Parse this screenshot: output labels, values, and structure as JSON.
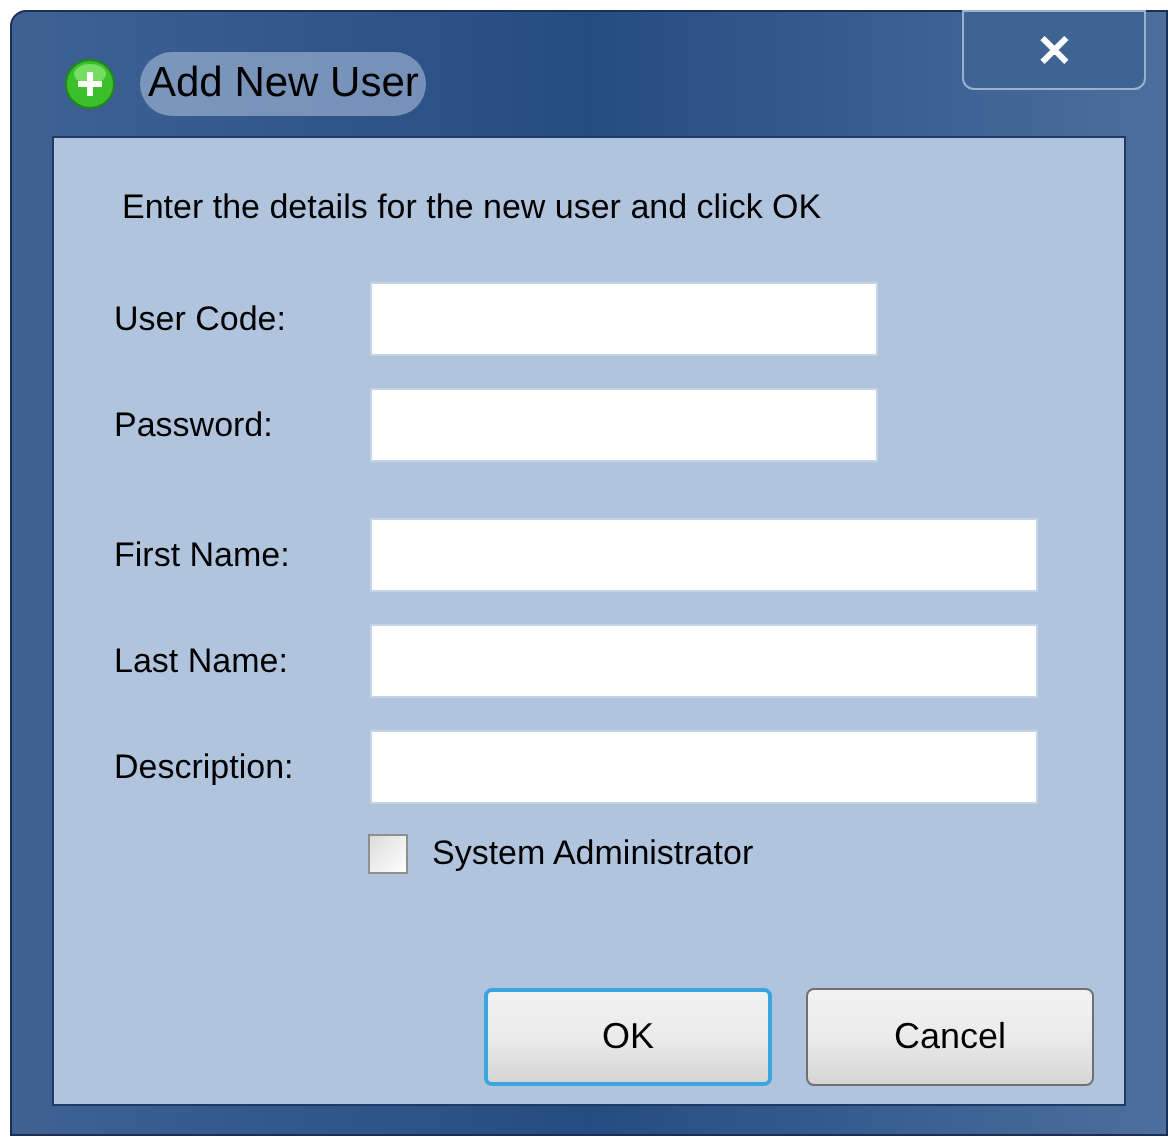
{
  "window": {
    "title": "Add New User",
    "close": "✕"
  },
  "instruction": "Enter the details for the new user and click OK",
  "field_groups": [
    {
      "kind": "account",
      "fields": [
        {
          "label": "User Code:"
        },
        {
          "label": "Password:"
        }
      ]
    },
    {
      "kind": "profile",
      "fields": [
        {
          "label": "First Name:"
        },
        {
          "label": "Last Name:"
        },
        {
          "label": "Description:"
        }
      ]
    }
  ],
  "checkbox": {
    "label": "System Administrator",
    "checked": false
  },
  "buttons": [
    {
      "label": "OK",
      "default": true
    },
    {
      "label": "Cancel",
      "default": false
    }
  ]
}
